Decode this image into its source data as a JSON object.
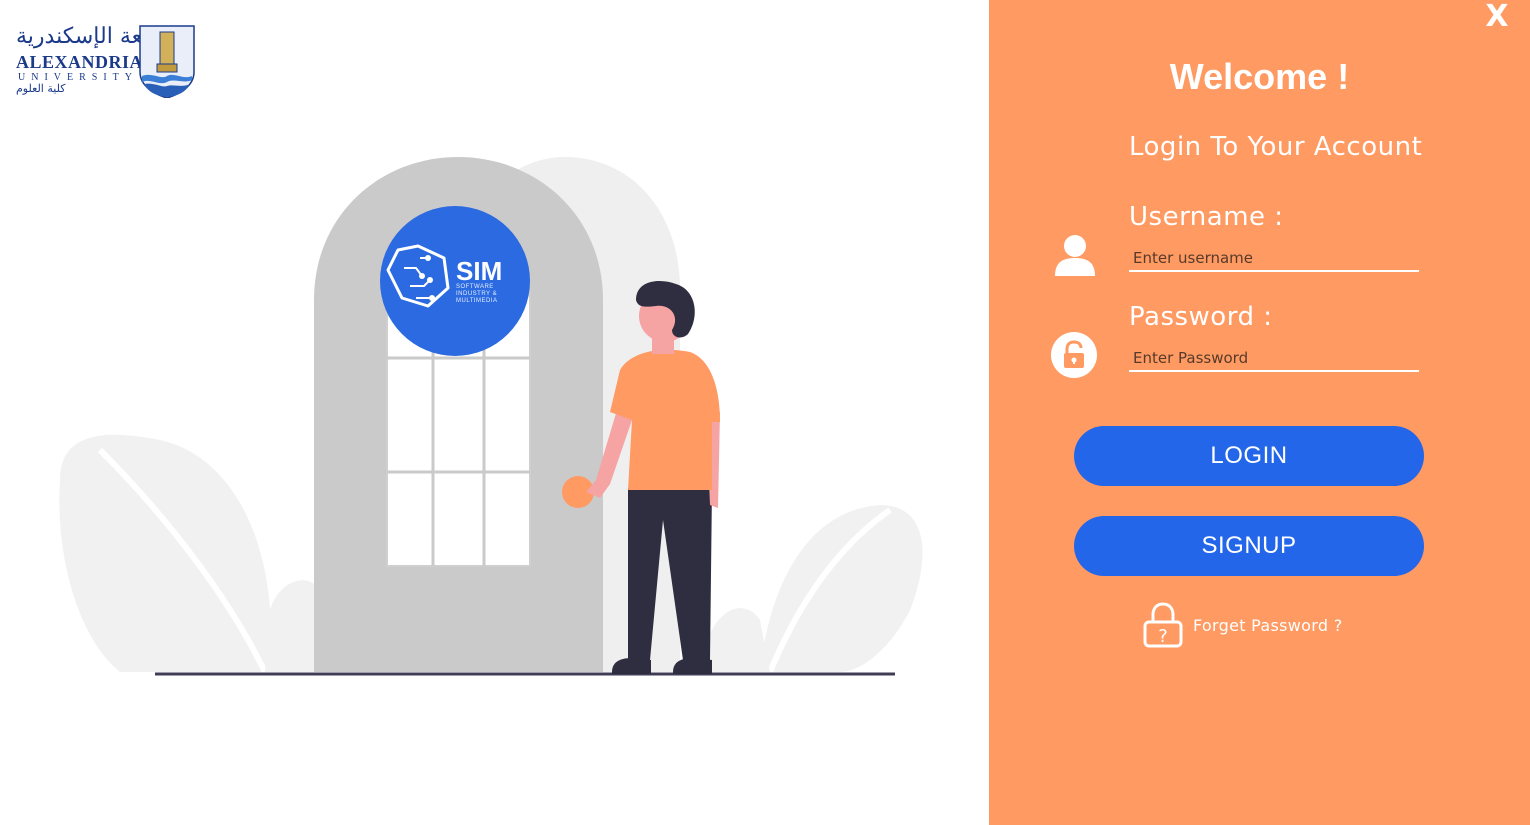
{
  "logo": {
    "arabic_name": "جامعة الإسكندرية",
    "english_name": "ALEXANDRIA",
    "english_sub": "UNIVERSITY",
    "faculty_arabic": "كلية العلوم"
  },
  "badge": {
    "title": "SIM",
    "subtitle": "SOFTWARE INDUSTRY & MULTIMEDIA"
  },
  "colors": {
    "panel": "#fe9a62",
    "button": "#2366ea",
    "badge": "#2b6ae0"
  },
  "panel": {
    "close_label": "X",
    "welcome": "Welcome !",
    "subtitle": "Login To Your Account",
    "username_label": "Username :",
    "username_placeholder": "Enter username",
    "password_label": "Password :",
    "password_placeholder": "Enter Password",
    "login_label": "LOGIN",
    "signup_label": "SIGNUP",
    "forgot_label": "Forget Password ?"
  },
  "icons": {
    "user": "user-icon",
    "lock": "lock-icon",
    "forgot": "lock-question-icon"
  }
}
